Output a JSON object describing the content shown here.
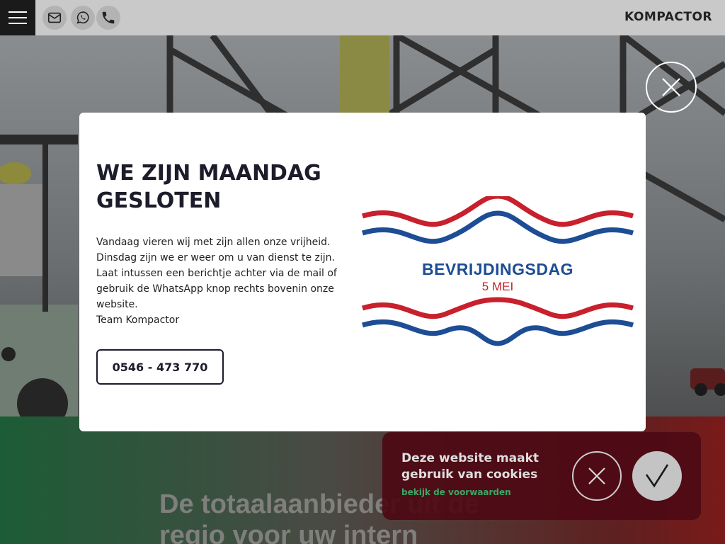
{
  "header": {
    "brand": "KOMPACTOR",
    "icons": [
      "hamburger-menu-icon",
      "mail-icon",
      "whatsapp-icon",
      "phone-icon"
    ]
  },
  "hero": {
    "tagline_line1": "De totaalaanbieder uit de",
    "tagline_line2": "regio voor uw intern"
  },
  "modal": {
    "title": "WE ZIJN MAANDAG GESLOTEN",
    "body_lines": [
      "Vandaag vieren wij met zijn allen onze vrijheid.",
      "Dinsdag zijn we er weer om u van dienst te zijn. Laat intussen een berichtje achter via de mail of gebruik de WhatsApp knop rechts bovenin onze website.",
      "Team Kompactor"
    ],
    "phone_button": "0546 - 473 770",
    "badge_title": "BEVRIJDINGSDAG",
    "badge_subtitle": "5 MEI"
  },
  "cookie": {
    "text": "Deze website maakt gebruik van cookies",
    "link": "bekijk de voorwaarden"
  },
  "colors": {
    "accent_dark": "#1c1c2a",
    "flag_red": "#c8202c",
    "flag_blue": "#1d4d94",
    "cookie_bg": "#4e0a14",
    "cookie_link": "#3aa766"
  }
}
